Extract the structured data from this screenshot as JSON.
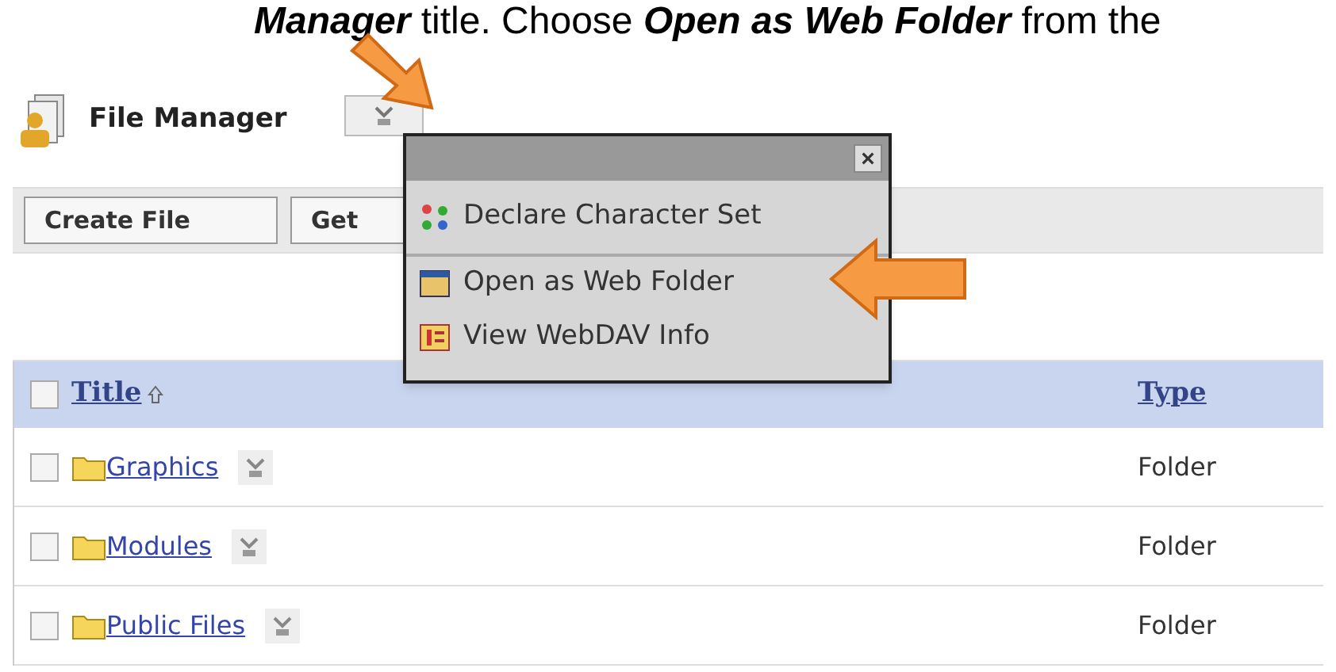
{
  "instruction": [
    {
      "text": "Manager",
      "emphasis": true
    },
    {
      "text": " title. Choose ",
      "emphasis": false
    },
    {
      "text": "Open as Web Folder",
      "emphasis": true
    },
    {
      "text": " from the",
      "emphasis": false
    }
  ],
  "header": {
    "title": "File Manager"
  },
  "toolbar": {
    "buttons": [
      "Create File",
      "Get"
    ]
  },
  "menu": {
    "close": "×",
    "items": [
      {
        "label": "Declare Character Set",
        "kind": "charset"
      },
      {
        "label": "Open as Web Folder",
        "kind": "webfolder"
      },
      {
        "label": "View WebDAV Info",
        "kind": "info"
      }
    ]
  },
  "table": {
    "header_checkbox": {
      "checked": false
    },
    "columns": [
      {
        "label": "Title",
        "sorted": true
      },
      {
        "label": "Type",
        "sorted": false
      }
    ],
    "rows": [
      {
        "title": "Graphics",
        "type": "Folder",
        "checked": false
      },
      {
        "title": "Modules",
        "type": "Folder",
        "checked": false
      },
      {
        "title": "Public Files",
        "type": "Folder",
        "checked": false
      }
    ]
  }
}
